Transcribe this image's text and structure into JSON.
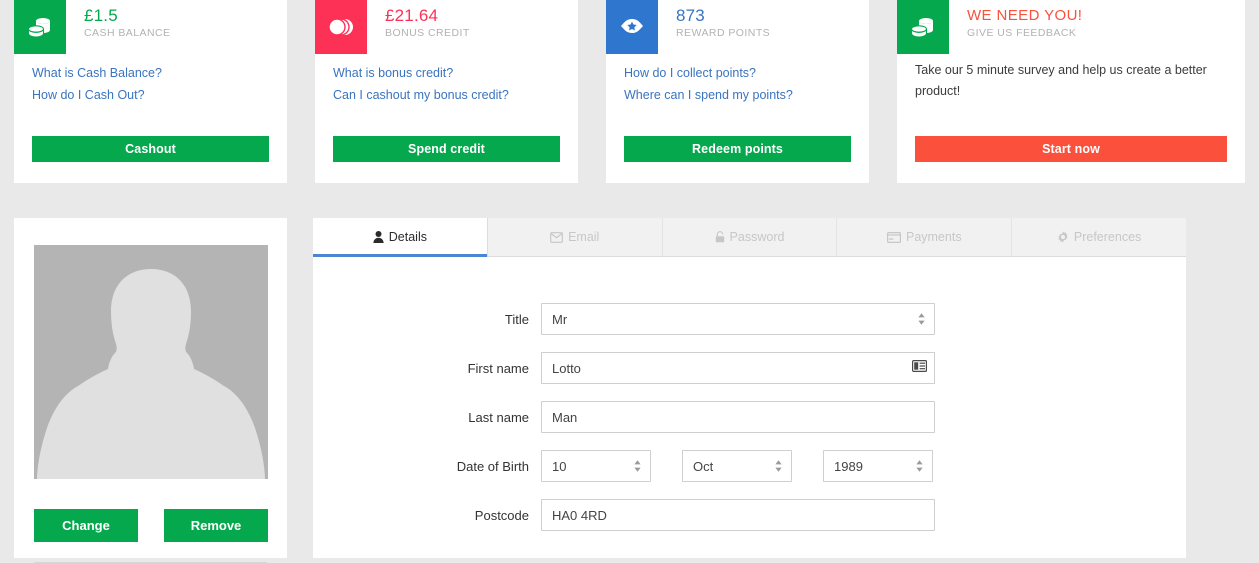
{
  "cards": [
    {
      "icon": "coins-stack-icon",
      "icon_style": "ic-green",
      "amount": "£1.5",
      "amount_style": "amt-green",
      "caption": "CASH BALANCE",
      "links": [
        "What is Cash Balance?",
        "How do I Cash Out?"
      ],
      "body": "",
      "button": "Cashout",
      "button_style": "btn-green"
    },
    {
      "icon": "coins-overlap-icon",
      "icon_style": "ic-pink",
      "amount": "£21.64",
      "amount_style": "amt-pink",
      "caption": "BONUS CREDIT",
      "links": [
        "What is bonus credit?",
        "Can I cashout my bonus credit?"
      ],
      "body": "",
      "button": "Spend credit",
      "button_style": "btn-green"
    },
    {
      "icon": "award-star-icon",
      "icon_style": "ic-blue",
      "amount": "873",
      "amount_style": "amt-blue",
      "caption": "REWARD POINTS",
      "links": [
        "How do I collect points?",
        "Where can I spend my points?"
      ],
      "body": "",
      "button": "Redeem points",
      "button_style": "btn-green"
    },
    {
      "icon": "coins-stack-icon",
      "icon_style": "ic-green",
      "amount": "WE NEED YOU!",
      "amount_style": "amt-orange",
      "caption": "GIVE US FEEDBACK",
      "links": [],
      "body": "Take our 5 minute survey and help us create a better product!",
      "button": "Start now",
      "button_style": "btn-orange"
    }
  ],
  "profile": {
    "avatar_alt": "default-user-silhouette",
    "change_label": "Change",
    "remove_label": "Remove"
  },
  "tabs": [
    {
      "label": "Details",
      "icon": "user-icon",
      "active": true
    },
    {
      "label": "Email",
      "icon": "envelope-icon",
      "active": false
    },
    {
      "label": "Password",
      "icon": "lock-icon",
      "active": false
    },
    {
      "label": "Payments",
      "icon": "credit-card-icon",
      "active": false
    },
    {
      "label": "Preferences",
      "icon": "gear-icon",
      "active": false
    }
  ],
  "form": {
    "title": {
      "label": "Title",
      "value": "Mr"
    },
    "first_name": {
      "label": "First name",
      "value": "Lotto",
      "placeholder": "First name"
    },
    "last_name": {
      "label": "Last name",
      "value": "Man",
      "placeholder": "Last name"
    },
    "dob": {
      "label": "Date of Birth",
      "day": "10",
      "month": "Oct",
      "year": "1989"
    },
    "postcode": {
      "label": "Postcode",
      "value": "HA0 4RD",
      "placeholder": "Postcode"
    }
  },
  "colors": {
    "green": "#06a84e",
    "pink": "#fd3055",
    "blue": "#2f76ce",
    "link_blue": "#3a74bf",
    "orange": "#fa503c",
    "tab_underline": "#4a86d3",
    "page_bg": "#e9e9e9"
  }
}
